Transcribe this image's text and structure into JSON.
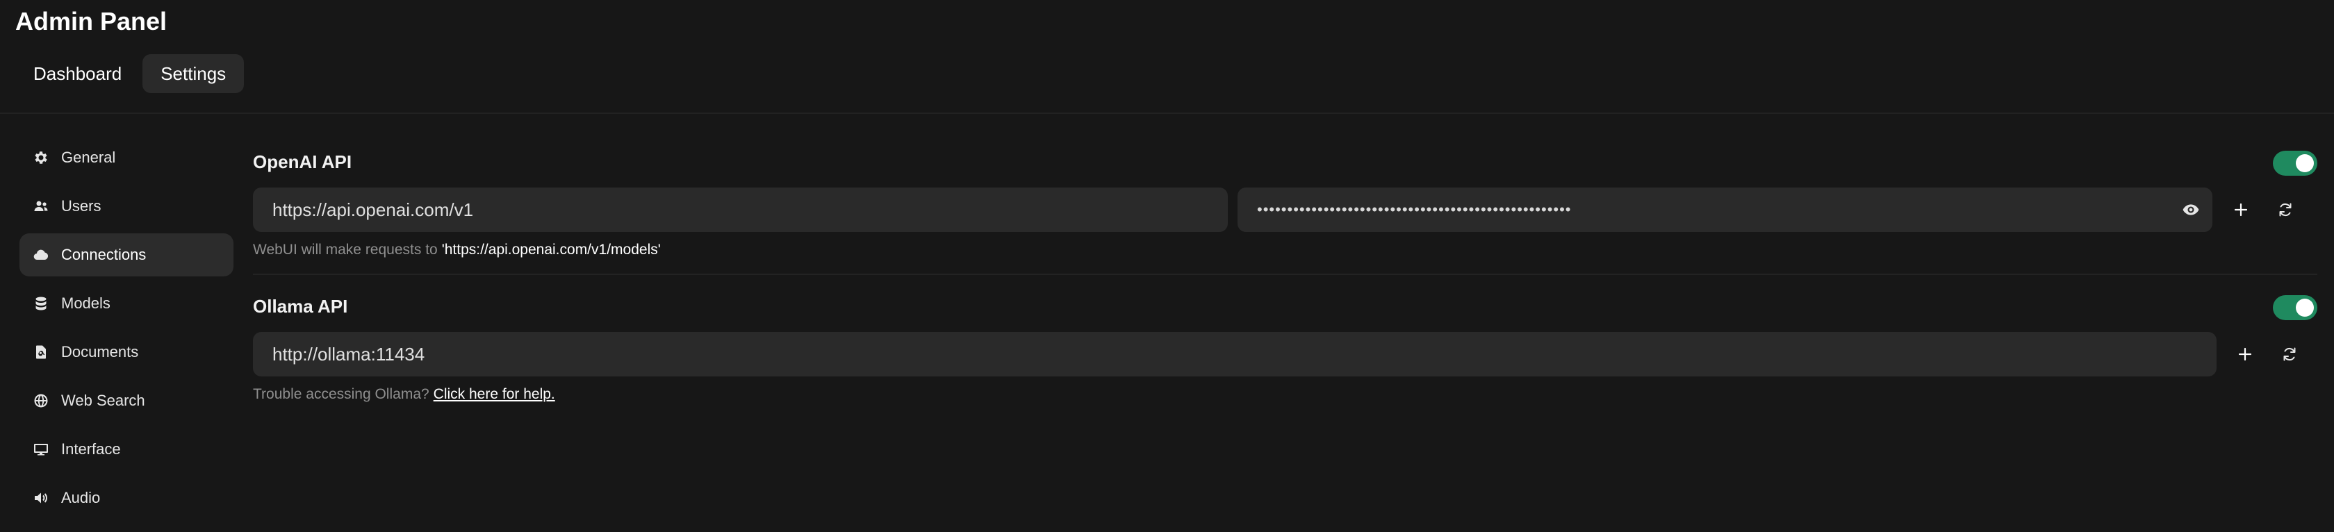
{
  "app": {
    "title": "Admin Panel"
  },
  "tabs": [
    {
      "label": "Dashboard",
      "active": false
    },
    {
      "label": "Settings",
      "active": true
    }
  ],
  "sidebar": {
    "items": [
      {
        "label": "General",
        "icon": "gear-icon"
      },
      {
        "label": "Users",
        "icon": "users-icon"
      },
      {
        "label": "Connections",
        "icon": "cloud-icon",
        "active": true
      },
      {
        "label": "Models",
        "icon": "database-icon"
      },
      {
        "label": "Documents",
        "icon": "document-icon"
      },
      {
        "label": "Web Search",
        "icon": "globe-icon"
      },
      {
        "label": "Interface",
        "icon": "monitor-icon"
      },
      {
        "label": "Audio",
        "icon": "speaker-icon"
      }
    ]
  },
  "openai": {
    "title": "OpenAI API",
    "enabled": true,
    "url_value": "https://api.openai.com/v1",
    "key_value": "••••••••••••••••••••••••••••••••••••••••••••••••••••",
    "help_prefix": "WebUI will make requests to",
    "help_url": "'https://api.openai.com/v1/models'"
  },
  "ollama": {
    "title": "Ollama API",
    "enabled": true,
    "url_value": "http://ollama:11434",
    "help_prefix": "Trouble accessing Ollama?",
    "help_link": "Click here for help."
  },
  "colors": {
    "background": "#171717",
    "panel": "#2a2a2a",
    "toggle_on": "#1f8a5f"
  }
}
